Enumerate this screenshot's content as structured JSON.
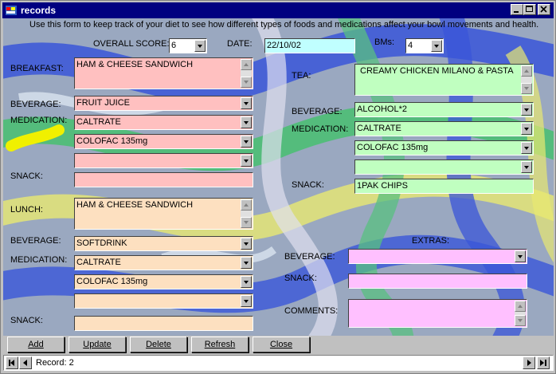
{
  "window": {
    "title": "records"
  },
  "header": {
    "instructions": "Use this form to keep track of your diet to see how different types of foods and medications affect your bowl movements and health.",
    "overall_score_label": "OVERALL SCORE:",
    "overall_score_value": "6",
    "date_label": "DATE:",
    "date_value": "22/10/02",
    "bms_label": "BMs:",
    "bms_value": "4"
  },
  "breakfast": {
    "label": "BREAKFAST:",
    "food": "HAM & CHEESE SANDWICH",
    "beverage_label": "BEVERAGE:",
    "beverage": "FRUIT JUICE",
    "medication_label": "MEDICATION:",
    "medications": [
      "CALTRATE",
      "COLOFAC 135mg",
      ""
    ],
    "snack_label": "SNACK:",
    "snack": ""
  },
  "lunch": {
    "label": "LUNCH:",
    "food": "HAM & CHEESE SANDWICH",
    "beverage_label": "BEVERAGE:",
    "beverage": "SOFTDRINK",
    "medication_label": "MEDICATION:",
    "medications": [
      "CALTRATE",
      "COLOFAC 135mg",
      ""
    ],
    "snack_label": "SNACK:",
    "snack": ""
  },
  "tea": {
    "label": "TEA:",
    "food": "CREAMY CHICKEN MILANO & PASTA",
    "beverage_label": "BEVERAGE:",
    "beverage": "ALCOHOL*2",
    "medication_label": "MEDICATION:",
    "medications": [
      "CALTRATE",
      "COLOFAC 135mg",
      ""
    ],
    "snack_label": "SNACK:",
    "snack": "1PAK CHIPS"
  },
  "extras": {
    "heading": "EXTRAS:",
    "beverage_label": "BEVERAGE:",
    "beverage": "",
    "snack_label": "SNACK:",
    "snack": "",
    "comments_label": "COMMENTS:",
    "comments": ""
  },
  "buttons": {
    "add": "Add",
    "update": "Update",
    "delete": "Delete",
    "refresh": "Refresh",
    "close": "Close"
  },
  "navigator": {
    "record_text": "Record: 2"
  },
  "colors": {
    "breakfast": "#ffc0c0",
    "lunch": "#fde0c0",
    "tea": "#c0ffc0",
    "extras": "#ffc0ff",
    "date": "#c0ffff",
    "titlebar": "#000080"
  }
}
